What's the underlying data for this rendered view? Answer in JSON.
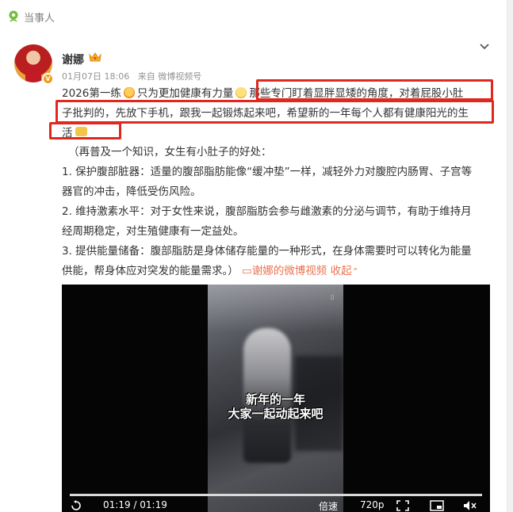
{
  "section": {
    "label": "当事人"
  },
  "author": {
    "name": "谢娜",
    "verified_badge": "V"
  },
  "meta": {
    "date": "01月07日 18:06",
    "source": "来自 微博视频号"
  },
  "post": {
    "line1_a": "2026第一练",
    "line1_b": "只为更加健康有力量",
    "line1_c": "那些专门盯着显胖显矮的角度，对着屁股小肚",
    "line2": "子批判的，先放下手机，跟我一起锻炼起来吧，希望新的一年每个人都有健康阳光的生",
    "line3": "活",
    "intro": "（再普及一个知识，女生有小肚子的好处：",
    "p1a": "1. 保护腹部脏器：适量的腹部脂肪能像“缓冲垫”一样，减轻外力对腹腔内肠胃、子宫等",
    "p1b": "器官的冲击，降低受伤风险。",
    "p2a": "2. 维持激素水平：对于女性来说，腹部脂肪会参与雌激素的分泌与调节，有助于维持月",
    "p2b": "经周期稳定，对生殖健康有一定益处。",
    "p3a": "3. 提供能量储备：腹部脂肪是身体储存能量的一种形式，在身体需要时可以转化为能量",
    "p3b": "供能，帮身体应对突发的能量需求。）",
    "video_link": "谢娜的微博视频",
    "collapse": "收起"
  },
  "video": {
    "caption_line1": "新年的一年",
    "caption_line2": "大家一起动起来吧",
    "time": "01:19 / 01:19",
    "speed": "倍速",
    "quality": "720p",
    "progress": 1.0
  },
  "colors": {
    "link": "#eb7350",
    "highlight_box": "#e0281f",
    "meta": "#939393"
  },
  "icons": [
    "location-pin-icon",
    "crown-icon",
    "chevron-down-icon",
    "emoji-icon",
    "video-link-icon",
    "replay-icon",
    "fullscreen-icon",
    "pip-icon",
    "volume-icon"
  ]
}
